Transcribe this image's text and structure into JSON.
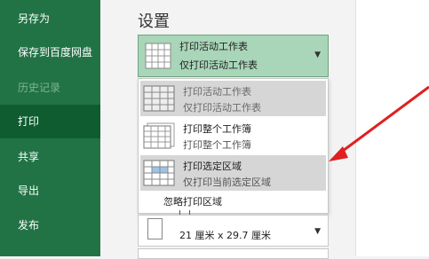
{
  "sidebar": {
    "items": [
      {
        "label": "另存为",
        "state": "normal"
      },
      {
        "label": "保存到百度网盘",
        "state": "normal"
      },
      {
        "label": "历史记录",
        "state": "disabled"
      },
      {
        "label": "打印",
        "state": "active"
      },
      {
        "label": "共享",
        "state": "normal"
      },
      {
        "label": "导出",
        "state": "normal"
      },
      {
        "label": "发布",
        "state": "normal"
      }
    ]
  },
  "settings": {
    "title": "设置",
    "scope_dropdown": {
      "selected_title": "打印活动工作表",
      "selected_subtitle": "仅打印活动工作表"
    },
    "options": [
      {
        "title": "打印活动工作表",
        "subtitle": "仅打印活动工作表",
        "icon": "sheet-icon"
      },
      {
        "title": "打印整个工作簿",
        "subtitle": "打印整个工作簿",
        "icon": "workbook-icon"
      },
      {
        "title": "打印选定区域",
        "subtitle": "仅打印当前选定区域",
        "icon": "selection-icon"
      }
    ],
    "ignore_print_area": "忽略打印区域",
    "paper_size": "21 厘米 x 29.7 厘米"
  },
  "colors": {
    "sidebar_bg": "#217346",
    "sidebar_active": "#0e5c30",
    "dropdown_bg": "#a9d5b8",
    "arrow": "#e02020"
  }
}
